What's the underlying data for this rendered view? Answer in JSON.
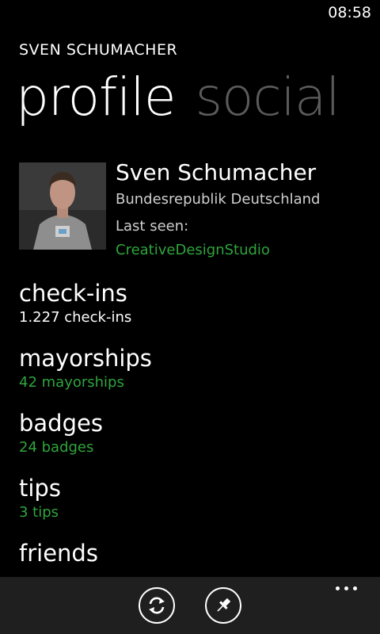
{
  "status_bar": {
    "time": "08:58"
  },
  "app_title": "SVEN SCHUMACHER",
  "pivot": {
    "active": "profile",
    "inactive": "social"
  },
  "profile": {
    "name": "Sven Schumacher",
    "country": "Bundesrepublik Deutschland",
    "last_seen_label": "Last seen:",
    "last_seen_venue": "CreativeDesignStudio"
  },
  "sections": [
    {
      "title": "check-ins",
      "subtitle": "1.227 check-ins"
    },
    {
      "title": "mayorships",
      "subtitle": "42 mayorships"
    },
    {
      "title": "badges",
      "subtitle": "24 badges"
    },
    {
      "title": "tips",
      "subtitle": "3 tips"
    },
    {
      "title": "friends",
      "subtitle": ""
    }
  ],
  "app_bar": {
    "buttons": [
      "refresh-icon",
      "pin-icon"
    ],
    "more": "ellipsis-icon"
  },
  "colors": {
    "accent": "#2fa43c",
    "background": "#000000",
    "app_bar": "#1f1f1f",
    "inactive_pivot": "#5b5b5b"
  }
}
